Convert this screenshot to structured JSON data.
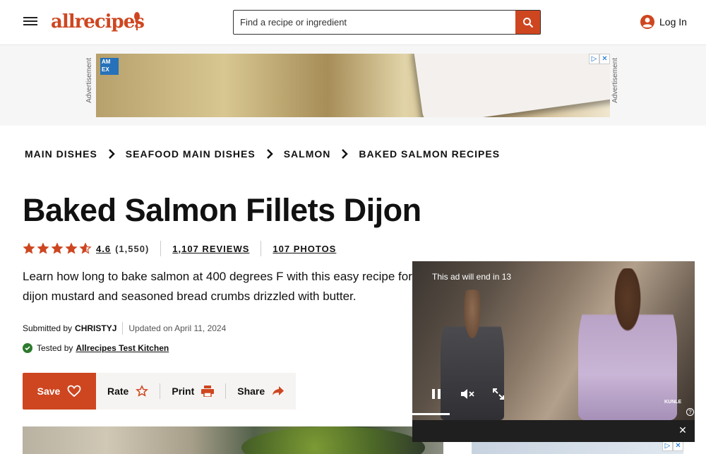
{
  "header": {
    "logo_text": "allrecipes",
    "search_placeholder": "Find a recipe or ingredient",
    "login_label": "Log In",
    "brand_color": "#ce4620",
    "icons": [
      "menu-icon",
      "search-icon",
      "account-icon"
    ]
  },
  "top_ad": {
    "label_left": "Advertisement",
    "label_right": "Advertisement",
    "brand": "AM EX"
  },
  "breadcrumbs": [
    {
      "label": "MAIN DISHES"
    },
    {
      "label": "SEAFOOD MAIN DISHES"
    },
    {
      "label": "SALMON"
    },
    {
      "label": "BAKED SALMON RECIPES"
    }
  ],
  "recipe": {
    "title": "Baked Salmon Fillets Dijon",
    "rating": "4.6",
    "rating_stars": 4.6,
    "rating_count": "(1,550)",
    "reviews_label": "1,107 REVIEWS",
    "photos_label": "107 PHOTOS",
    "description": "Learn how long to bake salmon at 400 degrees F with this easy recipe for dijon mustard and seasoned bread crumbs drizzled with butter.",
    "submitted_prefix": "Submitted by",
    "submitted_by": "CHRISTYJ",
    "updated": "Updated on April 11, 2024",
    "tested_prefix": "Tested by",
    "tested_by": "Allrecipes Test Kitchen"
  },
  "actions": {
    "save": "Save",
    "rate": "Rate",
    "print": "Print",
    "share": "Share"
  },
  "video": {
    "ad_countdown": "This ad will end in 13",
    "brand_mark": "KUNLE",
    "help": "?",
    "close": "✕"
  }
}
